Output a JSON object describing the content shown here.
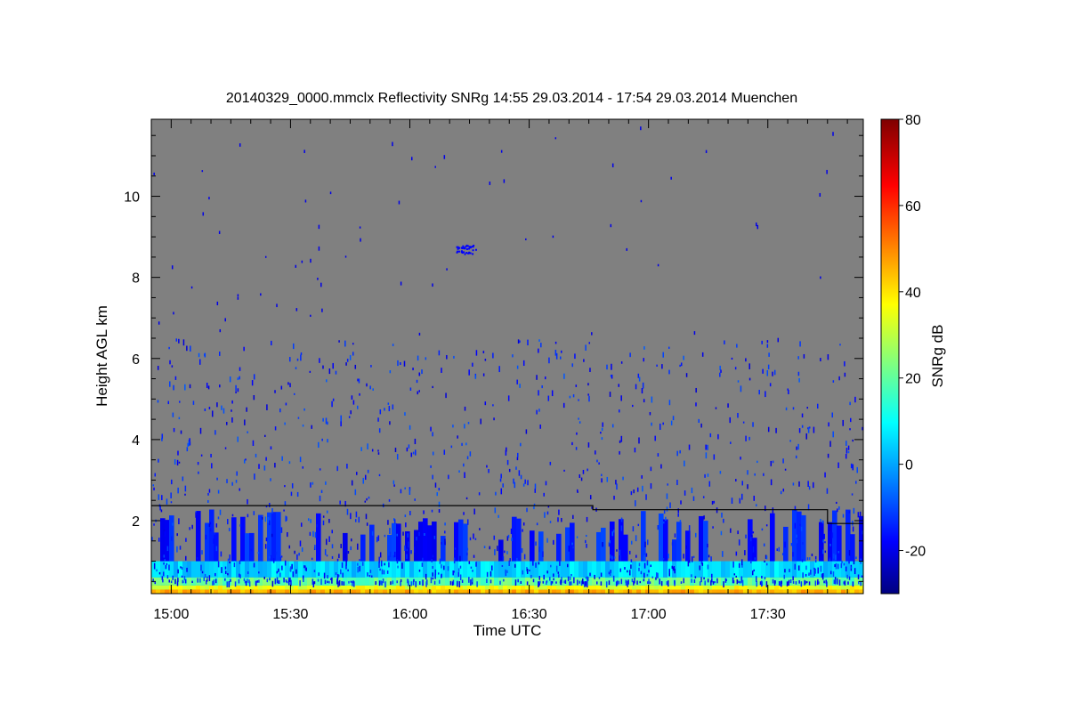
{
  "chart_data": {
    "type": "heatmap",
    "title": "20140329_0000.mmclx Reflectivity SNRg   14:55 29.03.2014 - 17:54 29.03.2014 Muenchen",
    "xlabel": "Time UTC",
    "ylabel": "Height AGL km",
    "colorbar_label": "SNRg dB",
    "xlim": [
      "14:55",
      "17:54"
    ],
    "ylim": [
      0.2,
      11.9
    ],
    "x_ticks": [
      "15:00",
      "15:30",
      "16:00",
      "16:30",
      "17:00",
      "17:30"
    ],
    "y_ticks": [
      2,
      4,
      6,
      8,
      10
    ],
    "colorbar_range": [
      -30,
      80
    ],
    "colorbar_ticks": [
      -20,
      0,
      20,
      40,
      60,
      80
    ],
    "background_color": "#808080",
    "colormap": [
      "#00007f",
      "#0000ff",
      "#007fff",
      "#00ffff",
      "#7fff7f",
      "#ffff00",
      "#ff7f00",
      "#ff0000",
      "#7f0000"
    ],
    "layers": [
      {
        "height_km": [
          0.2,
          0.3
        ],
        "snr_db": 45
      },
      {
        "height_km": [
          0.3,
          0.4
        ],
        "snr_db": 35
      },
      {
        "height_km": [
          0.4,
          0.6
        ],
        "snr_db": 20
      },
      {
        "height_km": [
          0.6,
          1.0
        ],
        "snr_db": 5
      },
      {
        "height_km": [
          1.0,
          2.3
        ],
        "snr_db": -15
      }
    ],
    "isolated_echo": {
      "time": "16:14",
      "height_km": 8.7,
      "snr_db": -18
    },
    "boundary_line": [
      {
        "time": "14:55",
        "height_km": 2.37
      },
      {
        "time": "16:46",
        "height_km": 2.37
      },
      {
        "time": "16:46",
        "height_km": 2.27
      },
      {
        "time": "17:45",
        "height_km": 2.27
      },
      {
        "time": "17:45",
        "height_km": 1.93
      },
      {
        "time": "17:54",
        "height_km": 1.93
      }
    ]
  }
}
